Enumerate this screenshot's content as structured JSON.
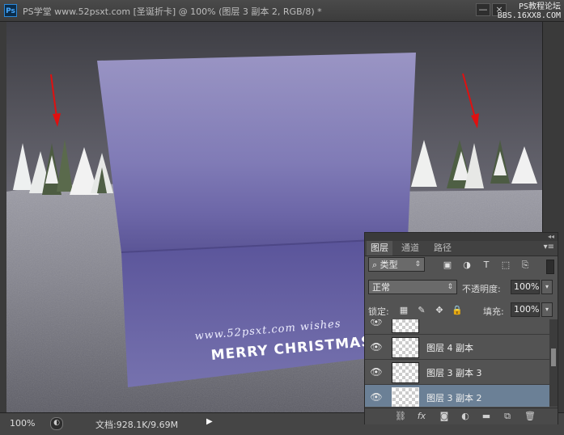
{
  "window": {
    "app_logo": "Ps",
    "title": "PS学堂 www.52psxt.com [圣诞折卡] @ 100% (图层 3 副本 2, RGB/8) *",
    "minimize_label": "—",
    "close_label": "×",
    "watermark_line1": "PS教程论坛",
    "watermark_line2": "BBS.16XX8.COM"
  },
  "canvas": {
    "card_text_line1": "www.52psxt.com  wishes",
    "card_text_line2": "MERRY CHRISTMAS"
  },
  "statusbar": {
    "zoom": "100%",
    "doc_info": "文档:928.1K/9.69M"
  },
  "layers_panel": {
    "collapse_label": "◂◂",
    "tabs": [
      {
        "label": "图层",
        "active": true
      },
      {
        "label": "通道",
        "active": false
      },
      {
        "label": "路径",
        "active": false
      }
    ],
    "filter_kind": "类型",
    "blend_mode": "正常",
    "opacity_label": "不透明度:",
    "opacity_value": "100%",
    "lock_label": "锁定:",
    "fill_label": "填充:",
    "fill_value": "100%",
    "layers": [
      {
        "name": "",
        "selected": false,
        "visible": true
      },
      {
        "name": "图层 4 副本",
        "selected": false,
        "visible": true
      },
      {
        "name": "图层 3 副本 3",
        "selected": false,
        "visible": true
      },
      {
        "name": "图层 3 副本 2",
        "selected": true,
        "visible": true
      }
    ],
    "bottom_fx_label": "fx"
  }
}
